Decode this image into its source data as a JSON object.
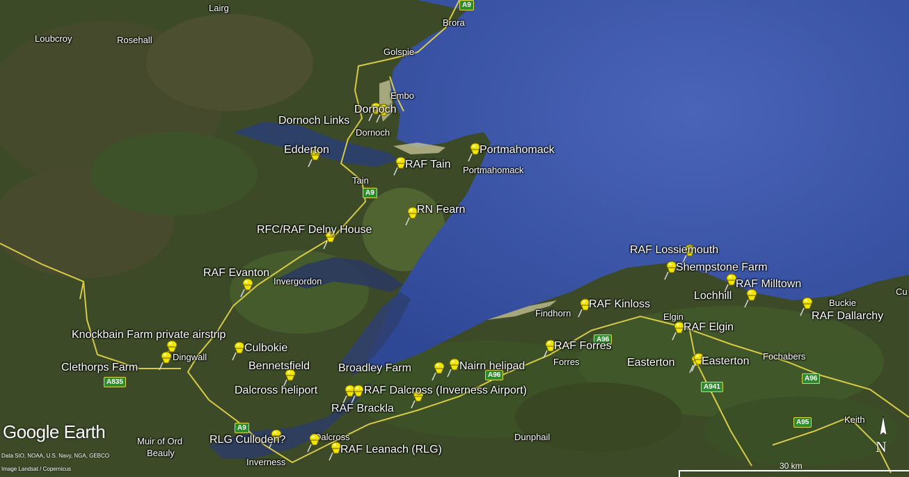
{
  "app": {
    "brand": "Google Earth",
    "credits": [
      "Data SIO, NOAA, U.S. Navy, NGA, GEBCO",
      "Image Landsat / Copernicus"
    ],
    "scale_label": "30 km",
    "compass_label": "N"
  },
  "colors": {
    "sea": "#3a55a8",
    "land": "#3c4a28",
    "road": "#e8d84a",
    "pin": "#f2e600"
  },
  "placemarks": [
    {
      "label": "Dornoch Links"
    },
    {
      "label": "Dornoch"
    },
    {
      "label": "Edderton"
    },
    {
      "label": "RAF Tain"
    },
    {
      "label": "Portmahomack"
    },
    {
      "label": "RN Fearn"
    },
    {
      "label": "RFC/RAF Delny House"
    },
    {
      "label": "RAF Evanton"
    },
    {
      "label": "RAF Lossiemouth"
    },
    {
      "label": "Shempstone Farm"
    },
    {
      "label": "RAF Milltown"
    },
    {
      "label": "Lochhill"
    },
    {
      "label": "RAF Kinloss"
    },
    {
      "label": "RAF Dallarchy"
    },
    {
      "label": "RAF Elgin"
    },
    {
      "label": "Knockbain Farm private airstrip"
    },
    {
      "label": "Culbokie"
    },
    {
      "label": "Clethorps Farm"
    },
    {
      "label": "Bennetsfield"
    },
    {
      "label": "Broadley Farm"
    },
    {
      "label": "Nairn helipad"
    },
    {
      "label": "RAF Forres"
    },
    {
      "label": "Easterton"
    },
    {
      "label": "Easterton"
    },
    {
      "label": "Dalcross heliport"
    },
    {
      "label": "RAF Dalcross (Inverness Airport)"
    },
    {
      "label": "RAF Brackla"
    },
    {
      "label": "RLG Culloden?"
    },
    {
      "label": "RAF Leanach (RLG)"
    }
  ],
  "places": [
    "Lairg",
    "Loubcroy",
    "Rosehall",
    "Brora",
    "Golspie",
    "Embo",
    "Dornoch",
    "Tain",
    "Portmahomack",
    "Invergordon",
    "Findhorn",
    "Buckie",
    "Elgin",
    "Forres",
    "Fochabers",
    "Dingwall",
    "Muir of Ord",
    "Beauly",
    "Inverness",
    "Dalcross",
    "Dunphail",
    "Keith",
    "Cu"
  ],
  "roads": [
    "A9",
    "A9",
    "A835",
    "A9",
    "A96",
    "A96",
    "A941",
    "A96",
    "A95"
  ]
}
